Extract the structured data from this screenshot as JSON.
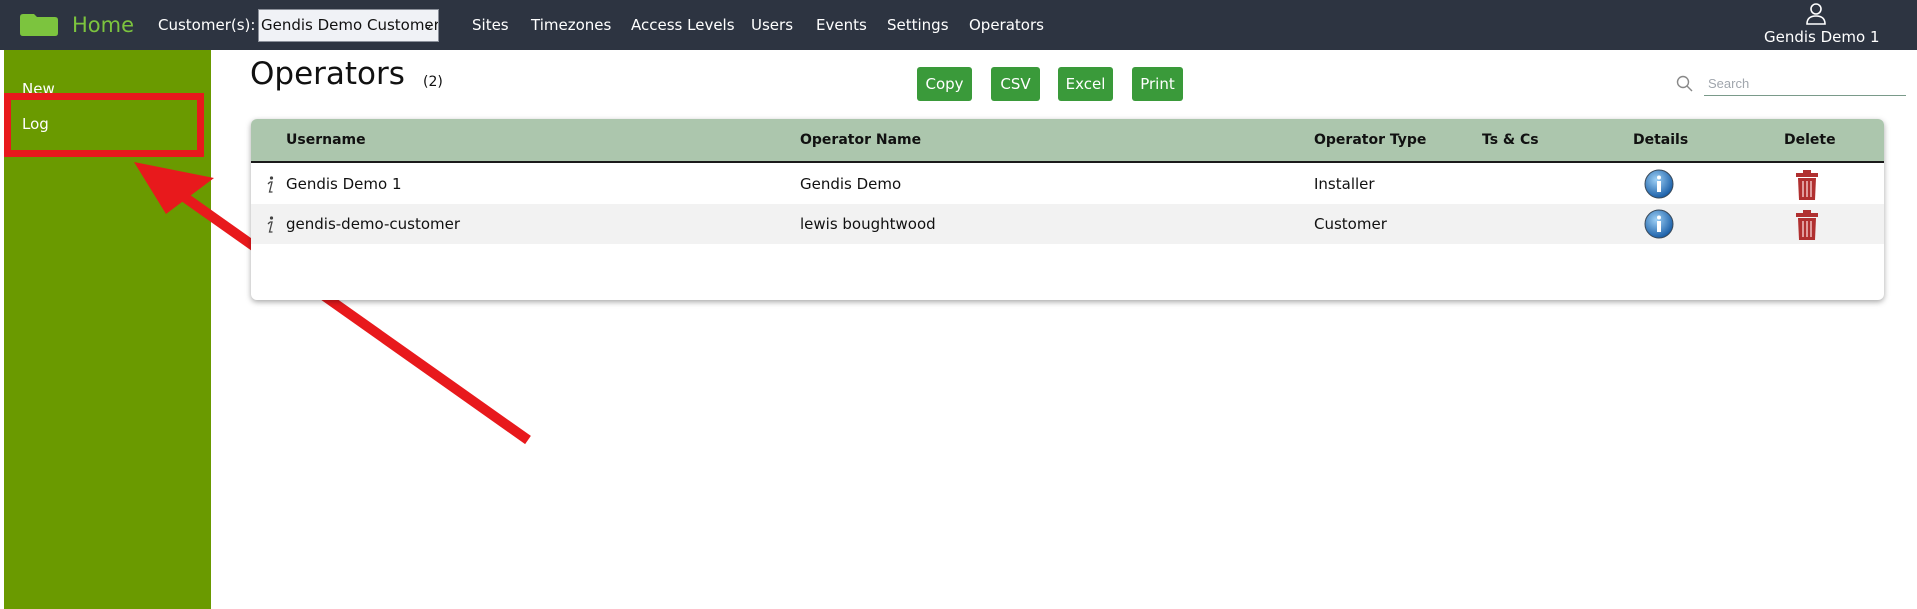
{
  "header": {
    "home_label": "Home",
    "customer_label": "Customer(s):",
    "customer_selected": "Gendis Demo Customer",
    "nav": [
      "Sites",
      "Timezones",
      "Access Levels",
      "Users",
      "Events",
      "Settings",
      "Operators"
    ],
    "user_name": "Gendis Demo 1"
  },
  "sidebar": {
    "items": [
      {
        "label": "New"
      },
      {
        "label": "Log"
      }
    ]
  },
  "main": {
    "title": "Operators",
    "count": "(2)",
    "buttons": [
      "Copy",
      "CSV",
      "Excel",
      "Print"
    ],
    "search": {
      "placeholder": "Search",
      "value": ""
    }
  },
  "table": {
    "columns": [
      "Username",
      "Operator Name",
      "Operator Type",
      "Ts & Cs",
      "Details",
      "Delete"
    ],
    "rows": [
      {
        "username": "Gendis Demo 1",
        "operator_name": "Gendis Demo",
        "operator_type": "Installer",
        "ts_cs": ""
      },
      {
        "username": "gendis-demo-customer",
        "operator_name": "lewis boughtwood",
        "operator_type": "Customer",
        "ts_cs": ""
      }
    ]
  },
  "colors": {
    "topbar": "#2d3441",
    "sidebar": "#6a9a00",
    "brand_green": "#7cc43e",
    "button_green": "#3a9a3a",
    "table_header": "#acc6ad",
    "annotation_red": "#e8191c"
  },
  "icons": {
    "logo": "folder-logo-icon",
    "user": "user-icon",
    "search": "search-icon",
    "row": "info-italic-icon",
    "details": "info-circle-icon",
    "delete": "trash-icon"
  }
}
